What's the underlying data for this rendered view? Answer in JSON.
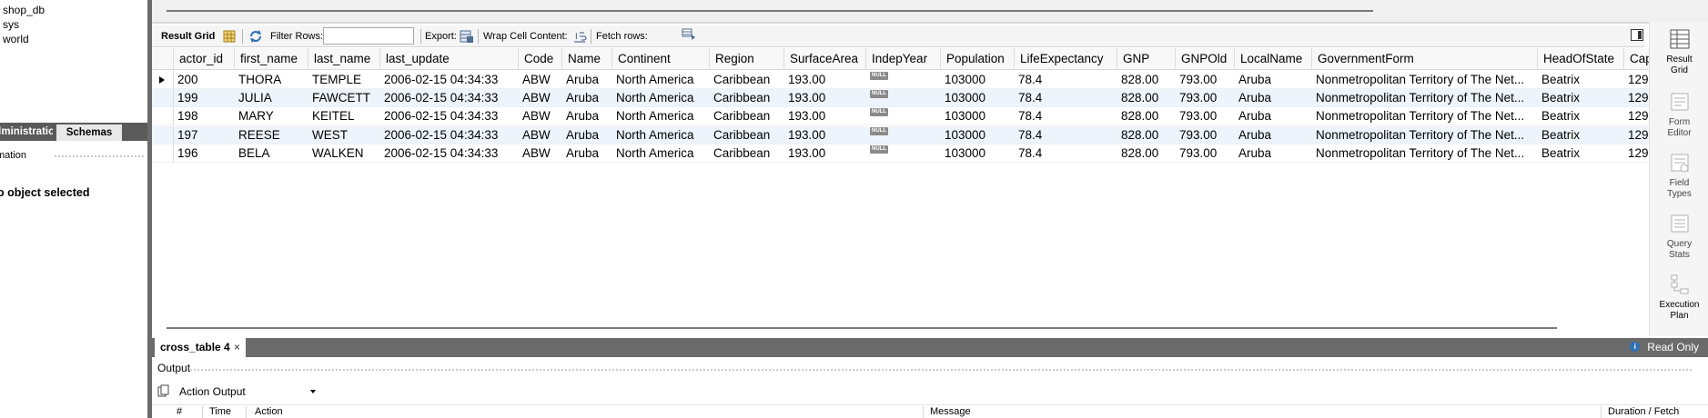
{
  "navigator": {
    "schemas": [
      "shop_db",
      "sys",
      "world"
    ],
    "tabs": {
      "administration": "Administration",
      "schemas": "Schemas"
    },
    "info_label": "Information",
    "info_text": "No object selected"
  },
  "toolbar": {
    "result_grid": "Result Grid",
    "filter_rows": "Filter Rows:",
    "filter_value": "",
    "export": "Export:",
    "wrap_cell": "Wrap Cell Content:",
    "fetch_rows": "Fetch rows:"
  },
  "grid": {
    "columns": [
      "actor_id",
      "first_name",
      "last_name",
      "last_update",
      "Code",
      "Name",
      "Continent",
      "Region",
      "SurfaceArea",
      "IndepYear",
      "Population",
      "LifeExpectancy",
      "GNP",
      "GNPOld",
      "LocalName",
      "GovernmentForm",
      "HeadOfState",
      "Cap"
    ],
    "null_label": "NULL",
    "rows": [
      [
        "200",
        "THORA",
        "TEMPLE",
        "2006-02-15 04:34:33",
        "ABW",
        "Aruba",
        "North America",
        "Caribbean",
        "193.00",
        "NULL",
        "103000",
        "78.4",
        "828.00",
        "793.00",
        "Aruba",
        "Nonmetropolitan Territory of The Net...",
        "Beatrix",
        "129"
      ],
      [
        "199",
        "JULIA",
        "FAWCETT",
        "2006-02-15 04:34:33",
        "ABW",
        "Aruba",
        "North America",
        "Caribbean",
        "193.00",
        "NULL",
        "103000",
        "78.4",
        "828.00",
        "793.00",
        "Aruba",
        "Nonmetropolitan Territory of The Net...",
        "Beatrix",
        "129"
      ],
      [
        "198",
        "MARY",
        "KEITEL",
        "2006-02-15 04:34:33",
        "ABW",
        "Aruba",
        "North America",
        "Caribbean",
        "193.00",
        "NULL",
        "103000",
        "78.4",
        "828.00",
        "793.00",
        "Aruba",
        "Nonmetropolitan Territory of The Net...",
        "Beatrix",
        "129"
      ],
      [
        "197",
        "REESE",
        "WEST",
        "2006-02-15 04:34:33",
        "ABW",
        "Aruba",
        "North America",
        "Caribbean",
        "193.00",
        "NULL",
        "103000",
        "78.4",
        "828.00",
        "793.00",
        "Aruba",
        "Nonmetropolitan Territory of The Net...",
        "Beatrix",
        "129"
      ],
      [
        "196",
        "BELA",
        "WALKEN",
        "2006-02-15 04:34:33",
        "ABW",
        "Aruba",
        "North America",
        "Caribbean",
        "193.00",
        "NULL",
        "103000",
        "78.4",
        "828.00",
        "793.00",
        "Aruba",
        "Nonmetropolitan Territory of The Net...",
        "Beatrix",
        "129"
      ]
    ]
  },
  "sidebar": {
    "result_grid": [
      "Result",
      "Grid"
    ],
    "form_editor": [
      "Form",
      "Editor"
    ],
    "field_types": [
      "Field",
      "Types"
    ],
    "query_stats": [
      "Query",
      "Stats"
    ],
    "execution_plan": [
      "Execution",
      "Plan"
    ]
  },
  "result_tab": {
    "label": "cross_table 4",
    "close": "×",
    "read_only": "Read Only",
    "info_icon": "i"
  },
  "output": {
    "title": "Output",
    "selector": "Action Output",
    "columns": {
      "num": "#",
      "time": "Time",
      "action": "Action",
      "message": "Message",
      "duration": "Duration / Fetch"
    }
  },
  "colors": {
    "accent": "#2f6fb4",
    "tab_bar": "#6b6b6b",
    "alt_row": "#eef4fb",
    "null_badge": "#8a8a8a"
  }
}
